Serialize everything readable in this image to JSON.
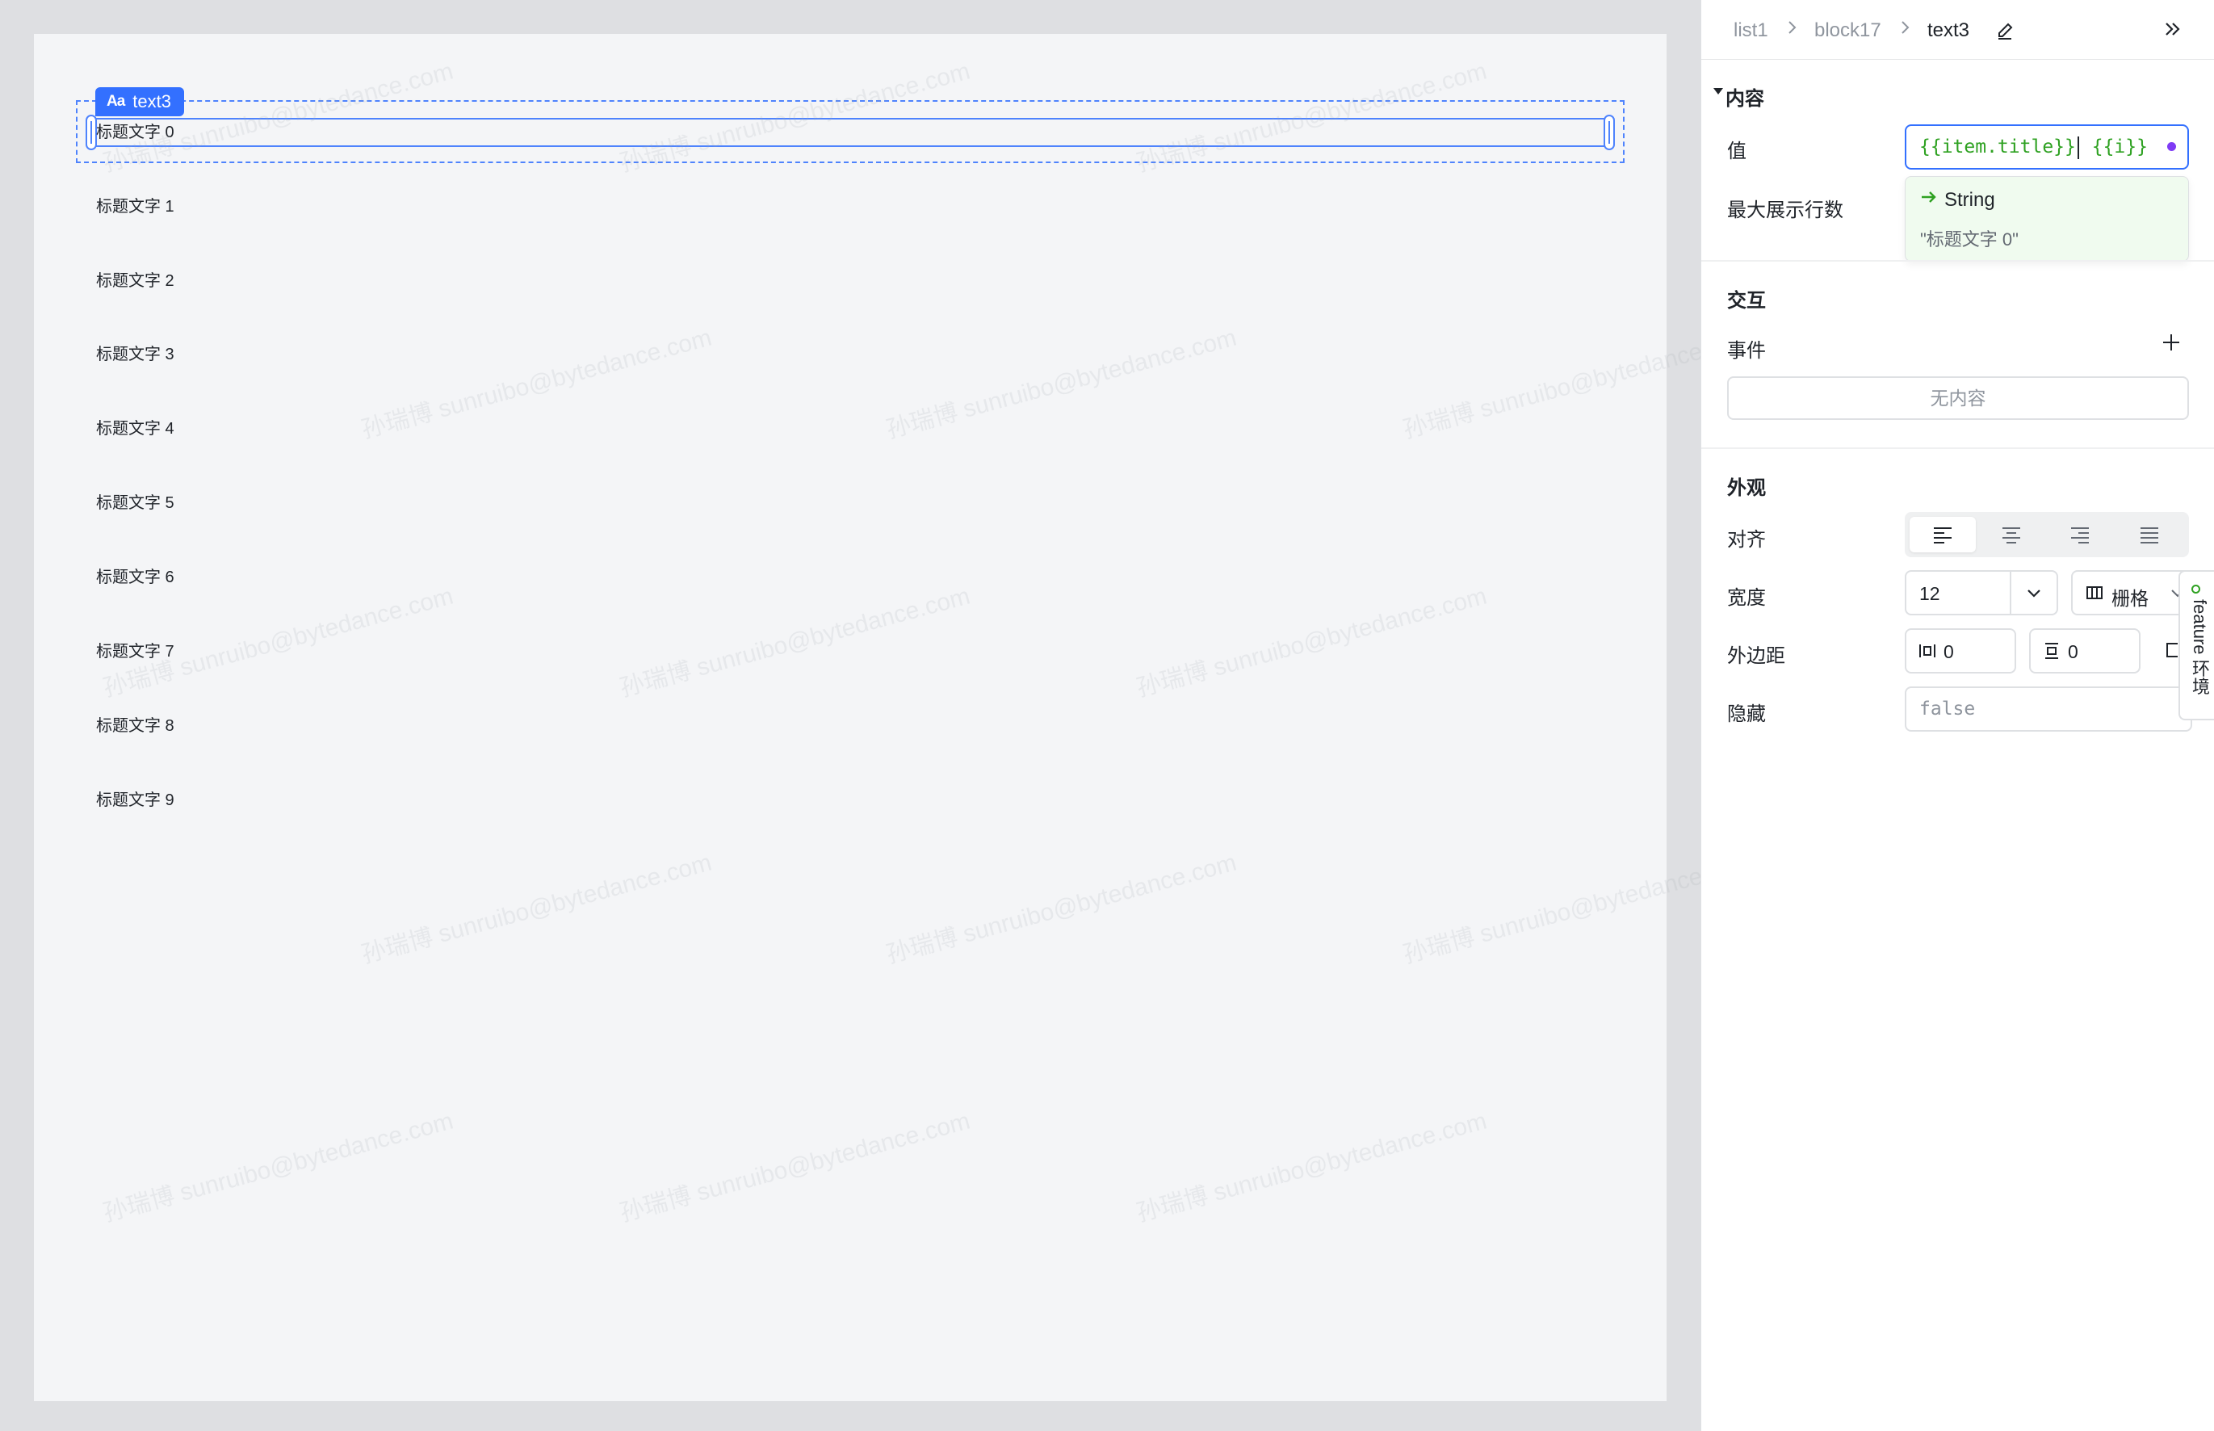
{
  "canvas": {
    "selected_component": {
      "tag_icon": "Aa",
      "tag_label": "text3"
    },
    "list_items": [
      "标题文字 0",
      "标题文字 1",
      "标题文字 2",
      "标题文字 3",
      "标题文字 4",
      "标题文字 5",
      "标题文字 6",
      "标题文字 7",
      "标题文字 8",
      "标题文字 9"
    ],
    "watermark": "孙瑞博 sunruibo@bytedance.com"
  },
  "panel": {
    "breadcrumb": [
      "list1",
      "block17",
      "text3"
    ],
    "icons": {
      "edit": "edit-icon",
      "collapse": "double-chevron-right-icon"
    },
    "content_section": {
      "title": "内容",
      "value_label": "值",
      "value_expression": {
        "part1": "{{item.title}}",
        "part2": "{{i}}"
      },
      "type_hint": {
        "type": "String",
        "value": "\"标题文字 0\""
      },
      "max_lines_label": "最大展示行数"
    },
    "interaction_section": {
      "title": "交互",
      "events_label": "事件",
      "events_empty": "无内容"
    },
    "appearance_section": {
      "title": "外观",
      "align_label": "对齐",
      "align_options": [
        "left",
        "center",
        "right",
        "justify"
      ],
      "align_selected": "left",
      "width_label": "宽度",
      "width_value": "12",
      "width_unit": "栅格",
      "margin_label": "外边距",
      "margin_horizontal": "0",
      "margin_vertical": "0",
      "hidden_label": "隐藏",
      "hidden_placeholder": "false"
    },
    "feature_tab": "feature 环境"
  },
  "colors": {
    "accent": "#3370ff",
    "selection": "#4e83fd",
    "expression_green": "#2ea121",
    "expression_blue": "#245bdb",
    "canvas_bg": "#f4f5f7",
    "workspace_bg": "#dedfe2"
  }
}
